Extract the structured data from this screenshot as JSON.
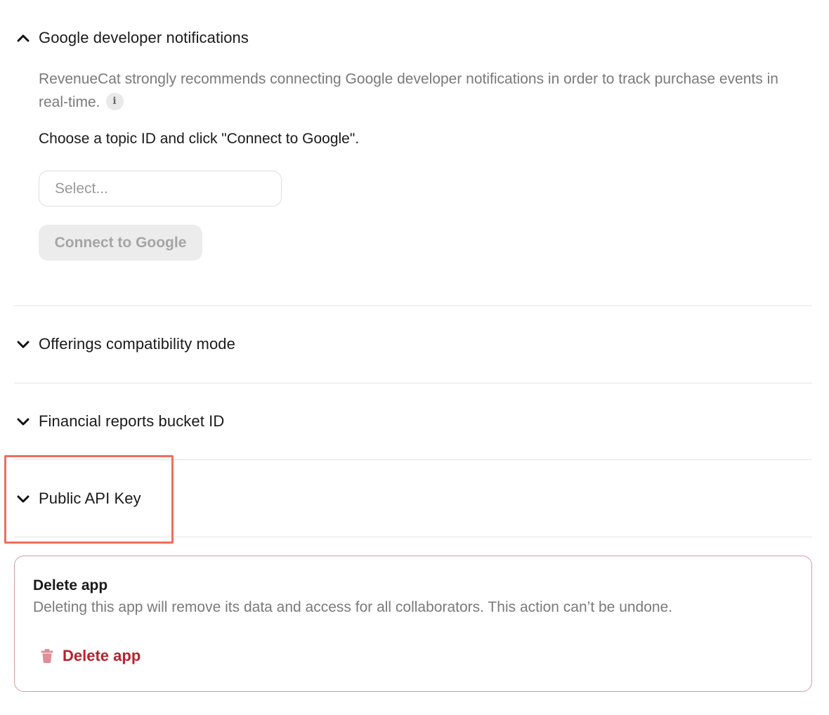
{
  "sections": {
    "google_notifications": {
      "title": "Google developer notifications",
      "expanded": true,
      "description": "RevenueCat strongly recommends connecting Google developer notifications in order to track purchase events in real-time.",
      "instruction": "Choose a topic ID and click \"Connect to Google\".",
      "select_placeholder": "Select...",
      "connect_label": "Connect to Google"
    },
    "offerings": {
      "title": "Offerings compatibility mode",
      "expanded": false
    },
    "financial": {
      "title": "Financial reports bucket ID",
      "expanded": false
    },
    "public_api": {
      "title": "Public API Key",
      "expanded": false
    }
  },
  "danger_zone": {
    "title": "Delete app",
    "description": "Deleting this app will remove its data and access for all collaborators. This action can’t be undone.",
    "button_label": "Delete app"
  },
  "icons": {
    "expanded": "chevron-up-icon",
    "collapsed": "chevron-down-icon",
    "info": "info-icon",
    "delete": "trash-icon"
  },
  "colors": {
    "danger": "#b3242e",
    "highlight": "#ee6e5e",
    "muted_text": "#7a7a7a"
  }
}
